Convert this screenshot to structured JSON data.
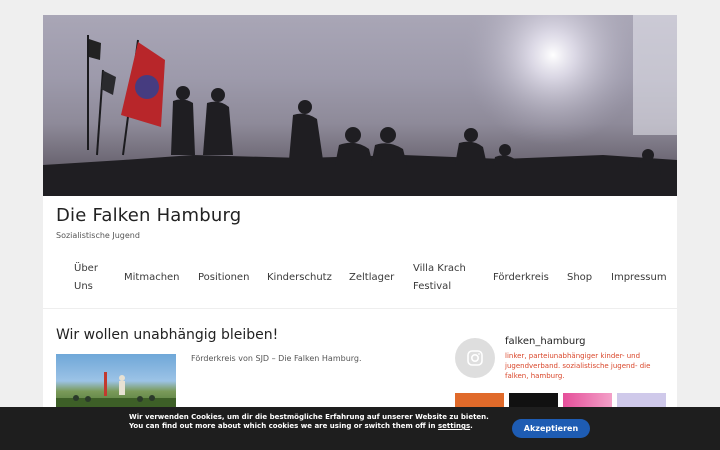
{
  "site": {
    "title": "Die Falken Hamburg",
    "tagline": "Sozialistische Jugend"
  },
  "nav": {
    "items": [
      {
        "line1": "Über",
        "line2": "Uns"
      },
      {
        "line1": "Mitmachen"
      },
      {
        "line1": "Positionen"
      },
      {
        "line1": "Kinderschutz"
      },
      {
        "line1": "Zeltlager"
      },
      {
        "line1": "Villa Krach",
        "line2": "Festival"
      },
      {
        "line1": "Förderkreis"
      },
      {
        "line1": "Shop"
      },
      {
        "line1": "Impressum"
      }
    ]
  },
  "post": {
    "title": "Wir wollen unabhängig bleiben!",
    "excerpt": "Förderkreis von SJD – Die Falken Hamburg."
  },
  "instagram": {
    "username": "falken_hamburg",
    "bio": "linker, parteiunabhängiger kinder- und jugendverband. sozialistische jugend- die falken, hamburg.",
    "icon": "instagram-icon"
  },
  "cookie": {
    "line1": "Wir verwenden Cookies, um dir die bestmögliche Erfahrung auf unserer Website zu bieten.",
    "line2_before": "You can find out more about which cookies we are using or switch them off in ",
    "line2_link": "settings",
    "line2_after": ".",
    "accept_label": "Akzeptieren"
  },
  "colors": {
    "accent": "#1e5cb3",
    "bio": "#d9472b",
    "cookie_bg": "#1e1e1e"
  }
}
